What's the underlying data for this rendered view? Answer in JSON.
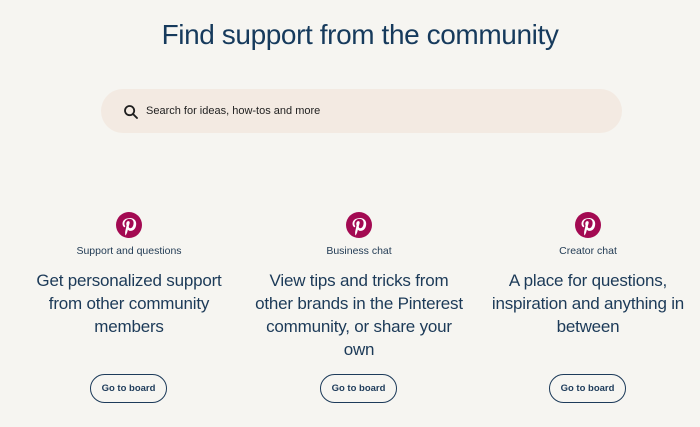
{
  "header": {
    "title": "Find support from the community"
  },
  "search": {
    "placeholder": "Search for ideas, how-tos and more",
    "icon": "search-icon"
  },
  "cards": [
    {
      "label": "Support and questions",
      "description": "Get personalized support from other community members",
      "button_label": "Go to board",
      "icon": "pinterest-logo-icon"
    },
    {
      "label": "Business chat",
      "description": "View tips and tricks from other brands in the Pinterest community, or share your own",
      "button_label": "Go to board",
      "icon": "pinterest-logo-icon"
    },
    {
      "label": "Creator chat",
      "description": "A place for questions, inspiration and anything in between",
      "button_label": "Go to board",
      "icon": "pinterest-logo-icon"
    }
  ],
  "colors": {
    "background": "#f6f5f1",
    "search_background": "#f3eae2",
    "text": "#1d3b5a",
    "brand_red": "#a30a52"
  }
}
